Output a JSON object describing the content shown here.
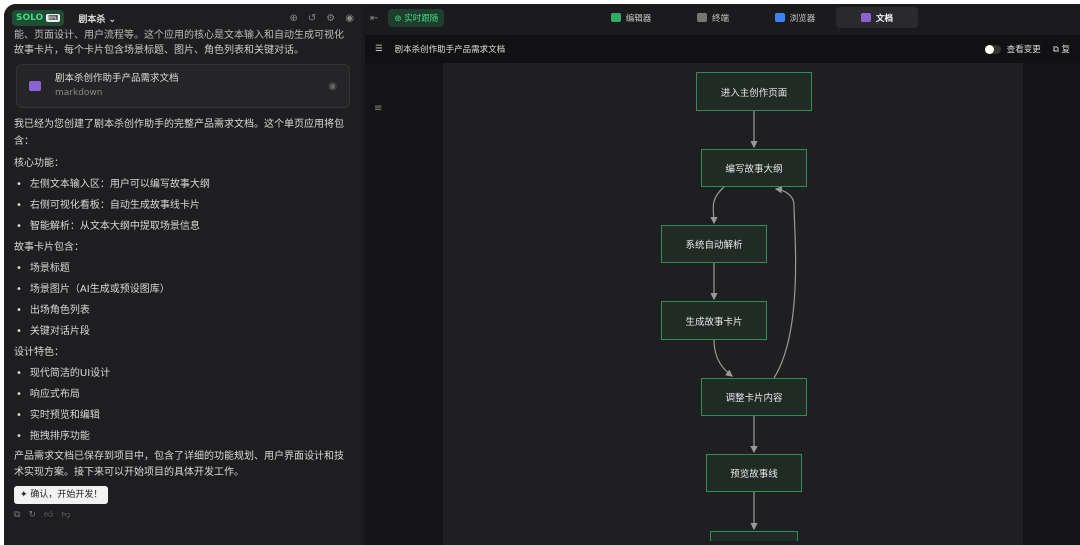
{
  "app": {
    "logo": "SOLO",
    "logo_badge": "⌨",
    "project": "剧本杀"
  },
  "chat": {
    "cut_line": "能、页面设计、用户流程等。这个应用的核心是文本输入和自动生成可视化",
    "intro2": "故事卡片，每个卡片包含场景标题、图片、角色列表和关键对话。",
    "file_card": {
      "title": "剧本杀创作助手产品需求文档",
      "type": "markdown"
    },
    "summary": "我已经为您创建了剧本杀创作助手的完整产品需求文档。这个单页应用将包含：",
    "sections": [
      {
        "title": "核心功能：",
        "items": [
          "左侧文本输入区：用户可以编写故事大纲",
          "右侧可视化看板：自动生成故事线卡片",
          "智能解析：从文本大纲中提取场景信息"
        ]
      },
      {
        "title": "故事卡片包含：",
        "items": [
          "场景标题",
          "场景图片（AI生成或预设图库）",
          "出场角色列表",
          "关键对话片段"
        ]
      },
      {
        "title": "设计特色：",
        "items": [
          "现代简洁的UI设计",
          "响应式布局",
          "实时预览和编辑",
          "拖拽排序功能"
        ]
      }
    ],
    "closing": "产品需求文档已保存到项目中，包含了详细的功能规划、用户界面设计和技术实现方案。接下来可以开始项目的具体开发工作。",
    "confirm_button": "✦ 确认，开始开发！"
  },
  "right": {
    "live_label": "实时跟随",
    "tabs": [
      {
        "label": "编辑器",
        "color": "#2fae6a"
      },
      {
        "label": "终端",
        "color": "#777777"
      },
      {
        "label": "浏览器",
        "color": "#3b82f6"
      },
      {
        "label": "文档",
        "color": "#8a63d2"
      }
    ],
    "doc_title": "剧本杀创作助手产品需求文档",
    "toggle_label": "查看变更",
    "copy_label": "复"
  },
  "flow": {
    "nodes": [
      "进入主创作页面",
      "编写故事大纲",
      "系统自动解析",
      "生成故事卡片",
      "调整卡片内容",
      "预览故事线",
      ""
    ]
  }
}
